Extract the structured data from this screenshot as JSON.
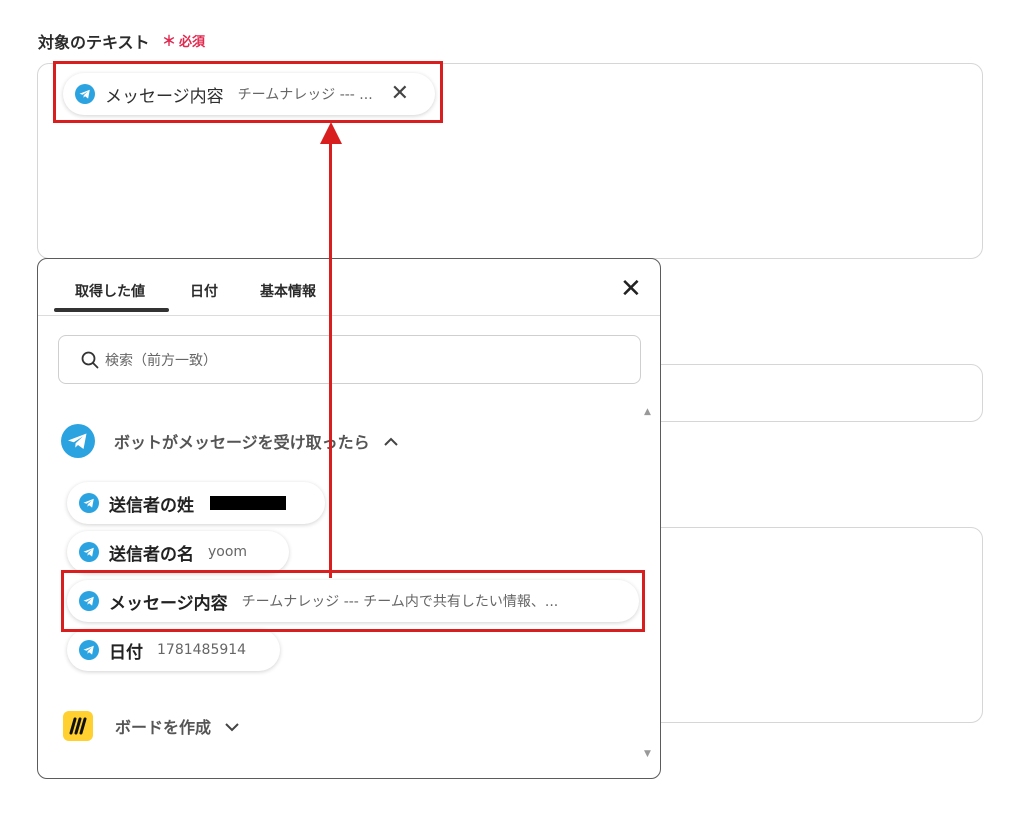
{
  "form": {
    "field_label": "対象のテキスト",
    "required_mark": "＊",
    "required_text": "必須"
  },
  "selected_chip": {
    "label": "メッセージ内容",
    "value": "チームナレッジ --- ...",
    "close": "✕"
  },
  "panel": {
    "tabs": [
      {
        "label": "取得した値",
        "active": true
      },
      {
        "label": "日付",
        "active": false
      },
      {
        "label": "基本情報",
        "active": false
      }
    ],
    "close": "✕",
    "search_placeholder": "検索（前方一致）",
    "groups": [
      {
        "label": "ボットがメッセージを受け取ったら",
        "icon": "telegram-icon",
        "chevron": "︿",
        "items": [
          {
            "label": "送信者の姓",
            "value": "",
            "redacted": true
          },
          {
            "label": "送信者の名",
            "value": "yoom"
          },
          {
            "label": "メッセージ内容",
            "value": "チームナレッジ --- チーム内で共有したい情報、..."
          },
          {
            "label": "日付",
            "value": "1781485914"
          }
        ]
      },
      {
        "label": "ボードを作成",
        "icon": "miro-icon",
        "chevron": "﹀"
      }
    ]
  },
  "colors": {
    "highlight": "#d81e1e",
    "required": "#e0294f",
    "telegram": "#2aa3e0",
    "miro": "#ffd02f"
  }
}
